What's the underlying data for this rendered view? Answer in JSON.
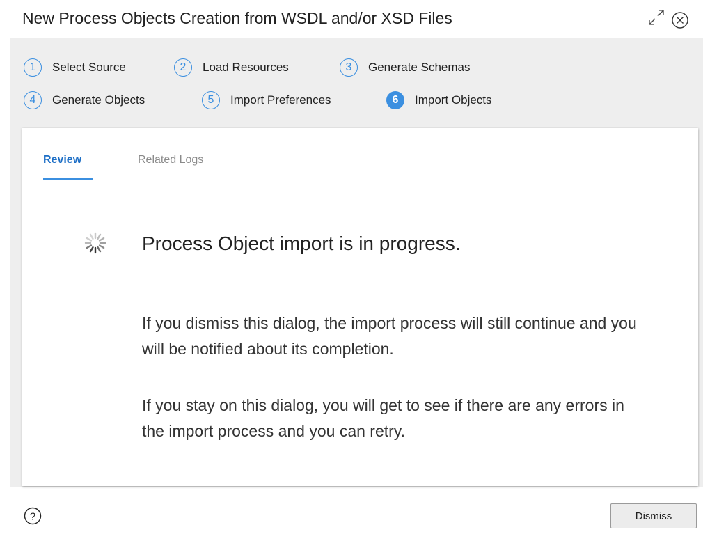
{
  "dialog": {
    "title": "New Process Objects Creation from WSDL and/or XSD Files",
    "expand_icon": "expand-icon",
    "close_icon": "close-icon"
  },
  "steps": [
    {
      "number": "1",
      "label": "Select Source",
      "active": false
    },
    {
      "number": "2",
      "label": "Load Resources",
      "active": false
    },
    {
      "number": "3",
      "label": "Generate Schemas",
      "active": false
    },
    {
      "number": "4",
      "label": "Generate Objects",
      "active": false
    },
    {
      "number": "5",
      "label": "Import Preferences",
      "active": false
    },
    {
      "number": "6",
      "label": "Import Objects",
      "active": true
    }
  ],
  "tabs": [
    {
      "label": "Review",
      "selected": true
    },
    {
      "label": "Related Logs",
      "selected": false
    }
  ],
  "content": {
    "heading": "Process Object import is in progress.",
    "para1": "If you dismiss this dialog, the import process will still continue and you will be notified about its completion.",
    "para2": "If you stay on this dialog, you will get to see if there are any errors in the import process and you can retry."
  },
  "footer": {
    "help_icon": "help-icon",
    "dismiss_label": "Dismiss"
  },
  "colors": {
    "accent": "#3b8fe0",
    "tab_selected": "#1e6fc6",
    "panel_bg": "#eeeeee"
  }
}
